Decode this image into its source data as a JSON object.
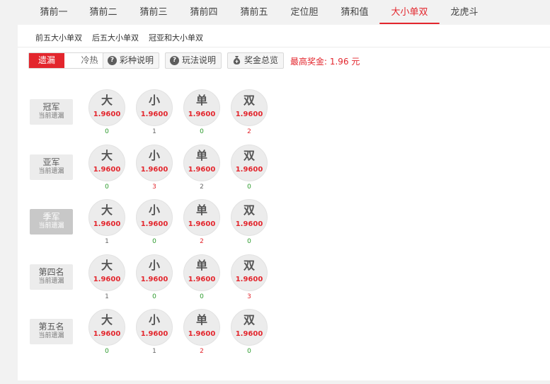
{
  "tabs": [
    {
      "label": "猜前一",
      "active": false
    },
    {
      "label": "猜前二",
      "active": false
    },
    {
      "label": "猜前三",
      "active": false
    },
    {
      "label": "猜前四",
      "active": false
    },
    {
      "label": "猜前五",
      "active": false
    },
    {
      "label": "定位胆",
      "active": false
    },
    {
      "label": "猜和值",
      "active": false
    },
    {
      "label": "大小单双",
      "active": true
    },
    {
      "label": "龙虎斗",
      "active": false
    }
  ],
  "subnav": [
    "前五大小单双",
    "后五大小单双",
    "冠亚和大小单双"
  ],
  "toggle": {
    "on": "遗漏",
    "off": "冷热"
  },
  "toolbar": {
    "lottery_info": "彩种说明",
    "rules": "玩法说明",
    "prize_overview": "奖金总览"
  },
  "max_prize": "最高奖金: 1.96 元",
  "options": [
    {
      "char": "大",
      "odds": "1.9600"
    },
    {
      "char": "小",
      "odds": "1.9600"
    },
    {
      "char": "单",
      "odds": "1.9600"
    },
    {
      "char": "双",
      "odds": "1.9600"
    }
  ],
  "rows": [
    {
      "name": "冠军",
      "sub": "当前遗漏",
      "active": false,
      "misses": [
        {
          "v": "0",
          "c": "green"
        },
        {
          "v": "1",
          "c": "gray"
        },
        {
          "v": "0",
          "c": "green"
        },
        {
          "v": "2",
          "c": "red"
        }
      ]
    },
    {
      "name": "亚军",
      "sub": "当前遗漏",
      "active": false,
      "misses": [
        {
          "v": "0",
          "c": "green"
        },
        {
          "v": "3",
          "c": "red"
        },
        {
          "v": "2",
          "c": "gray"
        },
        {
          "v": "0",
          "c": "green"
        }
      ]
    },
    {
      "name": "季军",
      "sub": "当前遗漏",
      "active": true,
      "misses": [
        {
          "v": "1",
          "c": "gray"
        },
        {
          "v": "0",
          "c": "green"
        },
        {
          "v": "2",
          "c": "red"
        },
        {
          "v": "0",
          "c": "green"
        }
      ]
    },
    {
      "name": "第四名",
      "sub": "当前遗漏",
      "active": false,
      "misses": [
        {
          "v": "1",
          "c": "gray"
        },
        {
          "v": "0",
          "c": "green"
        },
        {
          "v": "0",
          "c": "green"
        },
        {
          "v": "3",
          "c": "red"
        }
      ]
    },
    {
      "name": "第五名",
      "sub": "当前遗漏",
      "active": false,
      "misses": [
        {
          "v": "0",
          "c": "green"
        },
        {
          "v": "1",
          "c": "gray"
        },
        {
          "v": "2",
          "c": "red"
        },
        {
          "v": "0",
          "c": "green"
        }
      ]
    }
  ],
  "colors": {
    "accent": "#e3262d",
    "green": "#2a9a2a"
  }
}
